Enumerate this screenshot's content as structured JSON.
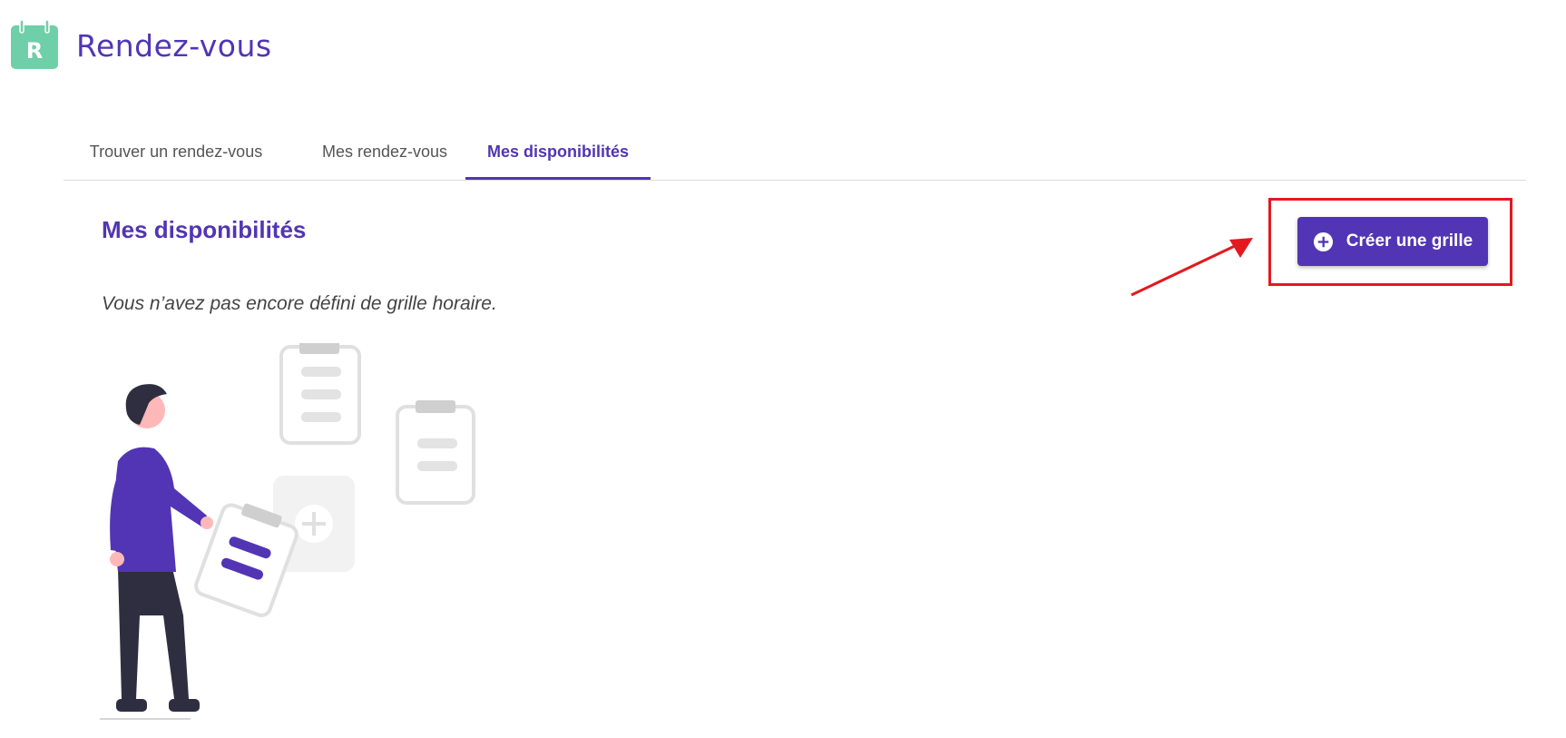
{
  "app": {
    "title": "Rendez-vous",
    "logo_icon": "calendar-logo-icon",
    "logo_letter": "R"
  },
  "tabs": [
    {
      "label": "Trouver un rendez-vous",
      "active": false
    },
    {
      "label": "Mes rendez-vous",
      "active": false
    },
    {
      "label": "Mes disponibilités",
      "active": true
    }
  ],
  "section": {
    "title": "Mes disponibilités",
    "empty_message": "Vous n’avez pas encore défini de grille horaire."
  },
  "create_button": {
    "label": "Créer une grille",
    "icon": "plus-circle-icon"
  },
  "illustration": {
    "icon": "person-with-clipboards-illustration"
  },
  "colors": {
    "brand": "#5235b4",
    "logo": "#6fcfa8",
    "annotation": "#e3191f",
    "divider": "#dcdcdc"
  }
}
